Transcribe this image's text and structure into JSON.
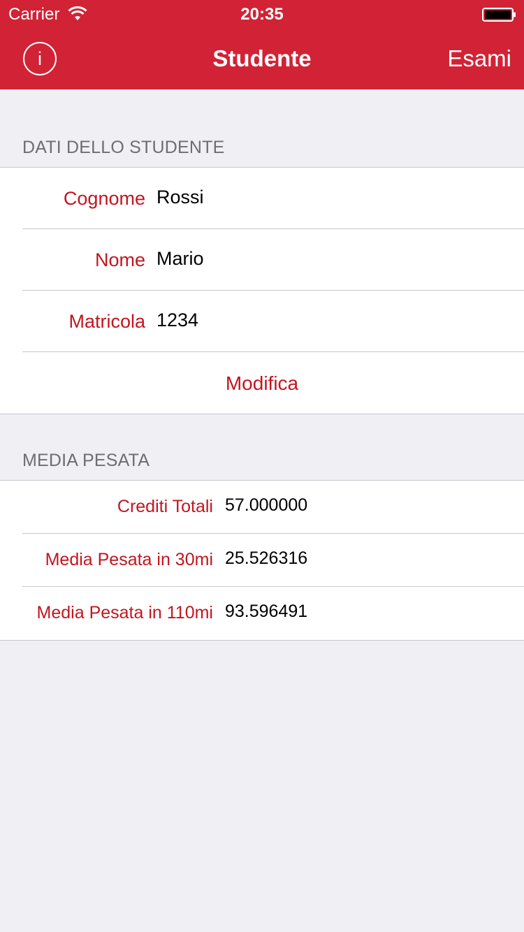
{
  "status_bar": {
    "carrier": "Carrier",
    "time": "20:35"
  },
  "nav": {
    "title": "Studente",
    "right_button": "Esami",
    "left_icon": "info-icon",
    "left_icon_glyph": "i"
  },
  "student_section": {
    "header": "DATI DELLO STUDENTE",
    "rows": [
      {
        "label": "Cognome",
        "value": "Rossi"
      },
      {
        "label": "Nome",
        "value": "Mario"
      },
      {
        "label": "Matricola",
        "value": "1234"
      }
    ],
    "edit_button": "Modifica"
  },
  "media_section": {
    "header": "MEDIA PESATA",
    "rows": [
      {
        "label": "Crediti Totali",
        "value": "57.000000"
      },
      {
        "label": "Media Pesata in 30mi",
        "value": "25.526316"
      },
      {
        "label": "Media Pesata in 110mi",
        "value": "93.596491"
      }
    ]
  },
  "colors": {
    "nav_background": "#d12335",
    "accent_text": "#c3151f",
    "page_background": "#efeff4",
    "section_header_text": "#6d6d72"
  }
}
